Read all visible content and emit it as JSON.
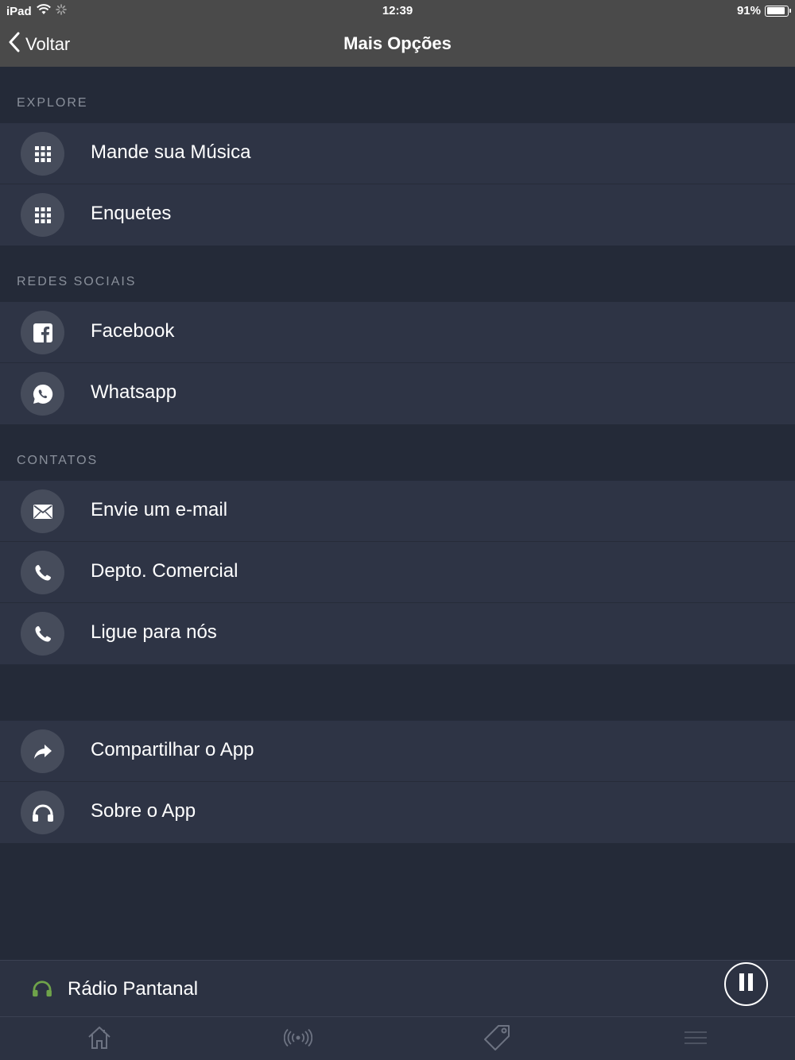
{
  "status_bar": {
    "device": "iPad",
    "time": "12:39",
    "battery": "91%",
    "battery_level": 0.91
  },
  "nav": {
    "back_label": "Voltar",
    "title": "Mais Opções"
  },
  "sections": [
    {
      "header": "EXPLORE",
      "items": [
        {
          "label": "Mande sua Música",
          "icon": "grid-icon"
        },
        {
          "label": "Enquetes",
          "icon": "grid-icon"
        }
      ]
    },
    {
      "header": "REDES SOCIAIS",
      "items": [
        {
          "label": "Facebook",
          "icon": "facebook-icon"
        },
        {
          "label": "Whatsapp",
          "icon": "whatsapp-icon"
        }
      ]
    },
    {
      "header": "CONTATOS",
      "items": [
        {
          "label": "Envie um e-mail",
          "icon": "mail-icon"
        },
        {
          "label": "Depto. Comercial",
          "icon": "phone-icon"
        },
        {
          "label": "Ligue para nós",
          "icon": "phone-icon"
        }
      ]
    },
    {
      "header": "",
      "items": [
        {
          "label": "Compartilhar o App",
          "icon": "share-icon"
        },
        {
          "label": "Sobre o App",
          "icon": "headphones-icon"
        }
      ]
    }
  ],
  "player": {
    "station": "Rádio Pantanal",
    "accent_color": "#6fa34a"
  },
  "tabs": [
    {
      "icon": "home-icon"
    },
    {
      "icon": "broadcast-icon"
    },
    {
      "icon": "tag-icon"
    },
    {
      "icon": "menu-icon"
    }
  ],
  "colors": {
    "background": "#242a38",
    "row": "#2e3445",
    "bar": "#4a4a4a",
    "section_header": "#8a909b"
  }
}
